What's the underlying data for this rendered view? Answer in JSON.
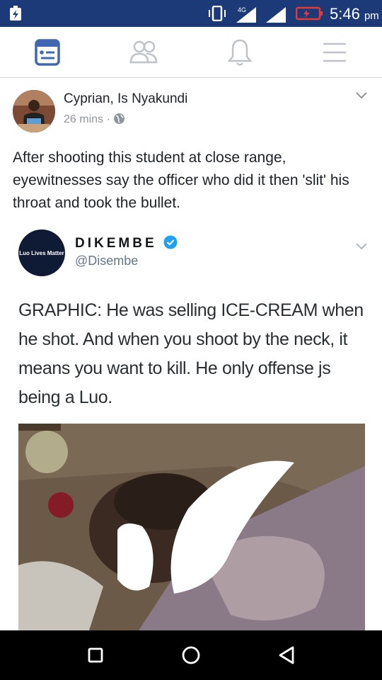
{
  "status_bar": {
    "network_label": "4G",
    "time": "5:46",
    "ampm": "pm",
    "icons": [
      "charging-icon",
      "vibrate-icon",
      "signal-icon",
      "signal-icon",
      "battery-icon"
    ],
    "colors": {
      "background": "#1c3a78",
      "battery_warning": "#e53935"
    }
  },
  "nav": {
    "items": [
      "news-feed-icon",
      "friends-icon",
      "notifications-icon",
      "menu-icon"
    ],
    "active": "news-feed-icon",
    "colors": {
      "active": "#4267b2",
      "inactive": "#bec3c9"
    }
  },
  "post": {
    "author": "Cyprian, Is  Nyakundi",
    "time": "26 mins",
    "separator": "·",
    "privacy_icon": "globe-icon",
    "text": "After shooting this student at close range, eyewitnesses say the officer who did it then 'slit' his throat and took the bullet."
  },
  "tweet": {
    "avatar_text": "Luo Lives Matter",
    "name": "DIKEMBE",
    "verified_icon": "verified-badge-icon",
    "handle": "@Disembe",
    "text": "GRAPHIC: He was selling ICE-CREAM when he shot. And when you shoot by the neck, it means you want to kill. He only offense js being a Luo.",
    "colors": {
      "verified": "#1da1f2"
    }
  },
  "android_nav": {
    "buttons": [
      "recents-square-icon",
      "home-circle-icon",
      "back-triangle-icon"
    ]
  }
}
